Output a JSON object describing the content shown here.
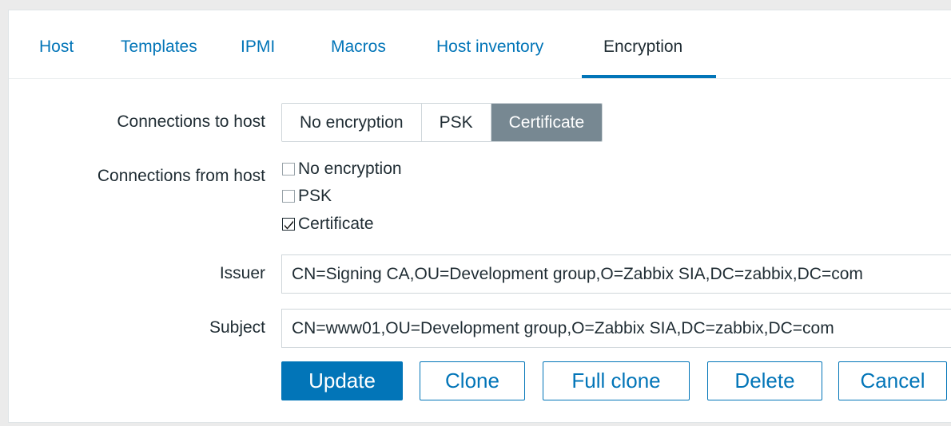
{
  "tabs": [
    {
      "label": "Host",
      "active": false
    },
    {
      "label": "Templates",
      "active": false
    },
    {
      "label": "IPMI",
      "active": false
    },
    {
      "label": "Macros",
      "active": false
    },
    {
      "label": "Host inventory",
      "active": false
    },
    {
      "label": "Encryption",
      "active": true
    }
  ],
  "form": {
    "connections_to_host": {
      "label": "Connections to host",
      "options": [
        "No encryption",
        "PSK",
        "Certificate"
      ],
      "selected": "Certificate"
    },
    "connections_from_host": {
      "label": "Connections from host",
      "options": [
        {
          "label": "No encryption",
          "checked": false
        },
        {
          "label": "PSK",
          "checked": false
        },
        {
          "label": "Certificate",
          "checked": true
        }
      ]
    },
    "issuer": {
      "label": "Issuer",
      "value": "CN=Signing CA,OU=Development group,O=Zabbix SIA,DC=zabbix,DC=com"
    },
    "subject": {
      "label": "Subject",
      "value": "CN=www01,OU=Development group,O=Zabbix SIA,DC=zabbix,DC=com"
    }
  },
  "buttons": {
    "update": "Update",
    "clone": "Clone",
    "full_clone": "Full clone",
    "delete": "Delete",
    "cancel": "Cancel"
  },
  "colors": {
    "accent": "#0275b8",
    "selected_segment": "#778892",
    "background": "#ebebeb"
  }
}
